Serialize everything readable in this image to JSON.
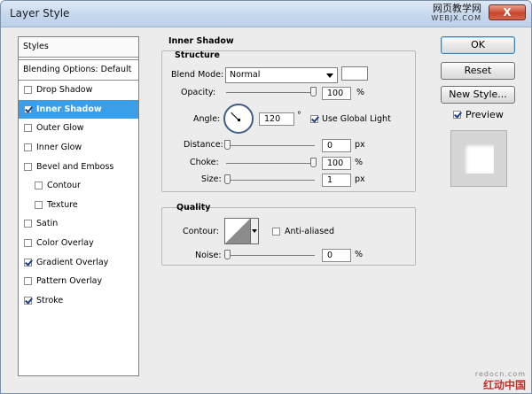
{
  "window": {
    "title": "Layer Style",
    "close_glyph": "X"
  },
  "watermark_top": {
    "line1": "网页教学网",
    "line2": "WEBJX.COM"
  },
  "watermark_bottom": {
    "line1": "redocn.com",
    "line2": "红动中国"
  },
  "styles_panel": {
    "header": "Styles",
    "blending_options": "Blending Options: Default",
    "items": [
      {
        "label": "Drop Shadow",
        "checked": false
      },
      {
        "label": "Inner Shadow",
        "checked": true,
        "selected": true
      },
      {
        "label": "Outer Glow",
        "checked": false
      },
      {
        "label": "Inner Glow",
        "checked": false
      },
      {
        "label": "Bevel and Emboss",
        "checked": false
      },
      {
        "label": "Contour",
        "checked": false,
        "sub": true
      },
      {
        "label": "Texture",
        "checked": false,
        "sub": true
      },
      {
        "label": "Satin",
        "checked": false
      },
      {
        "label": "Color Overlay",
        "checked": false
      },
      {
        "label": "Gradient Overlay",
        "checked": true
      },
      {
        "label": "Pattern Overlay",
        "checked": false
      },
      {
        "label": "Stroke",
        "checked": true
      }
    ]
  },
  "inner_shadow": {
    "section_title": "Inner Shadow",
    "structure_title": "Structure",
    "blend_mode": {
      "label": "Blend Mode:",
      "value": "Normal",
      "swatch_color": "#ffffff"
    },
    "opacity": {
      "label": "Opacity:",
      "value": "100",
      "unit": "%",
      "slider": 1.0
    },
    "angle": {
      "label": "Angle:",
      "value": "120",
      "unit": "°",
      "use_global_light": "Use Global Light",
      "global_checked": true
    },
    "distance": {
      "label": "Distance:",
      "value": "0",
      "unit": "px",
      "slider": 0.0
    },
    "choke": {
      "label": "Choke:",
      "value": "100",
      "unit": "%",
      "slider": 1.0
    },
    "size": {
      "label": "Size:",
      "value": "1",
      "unit": "px",
      "slider": 0.0
    }
  },
  "quality": {
    "title": "Quality",
    "contour_label": "Contour:",
    "anti_aliased": "Anti-aliased",
    "anti_aliased_checked": false,
    "noise": {
      "label": "Noise:",
      "value": "0",
      "unit": "%",
      "slider": 0.0
    }
  },
  "buttons": {
    "ok": "OK",
    "reset": "Reset",
    "new_style": "New Style...",
    "preview": "Preview",
    "preview_checked": true
  },
  "colors": {
    "selection": "#3a9ee9",
    "close_button": "#c9452c",
    "watermark_red": "#c4302b"
  }
}
